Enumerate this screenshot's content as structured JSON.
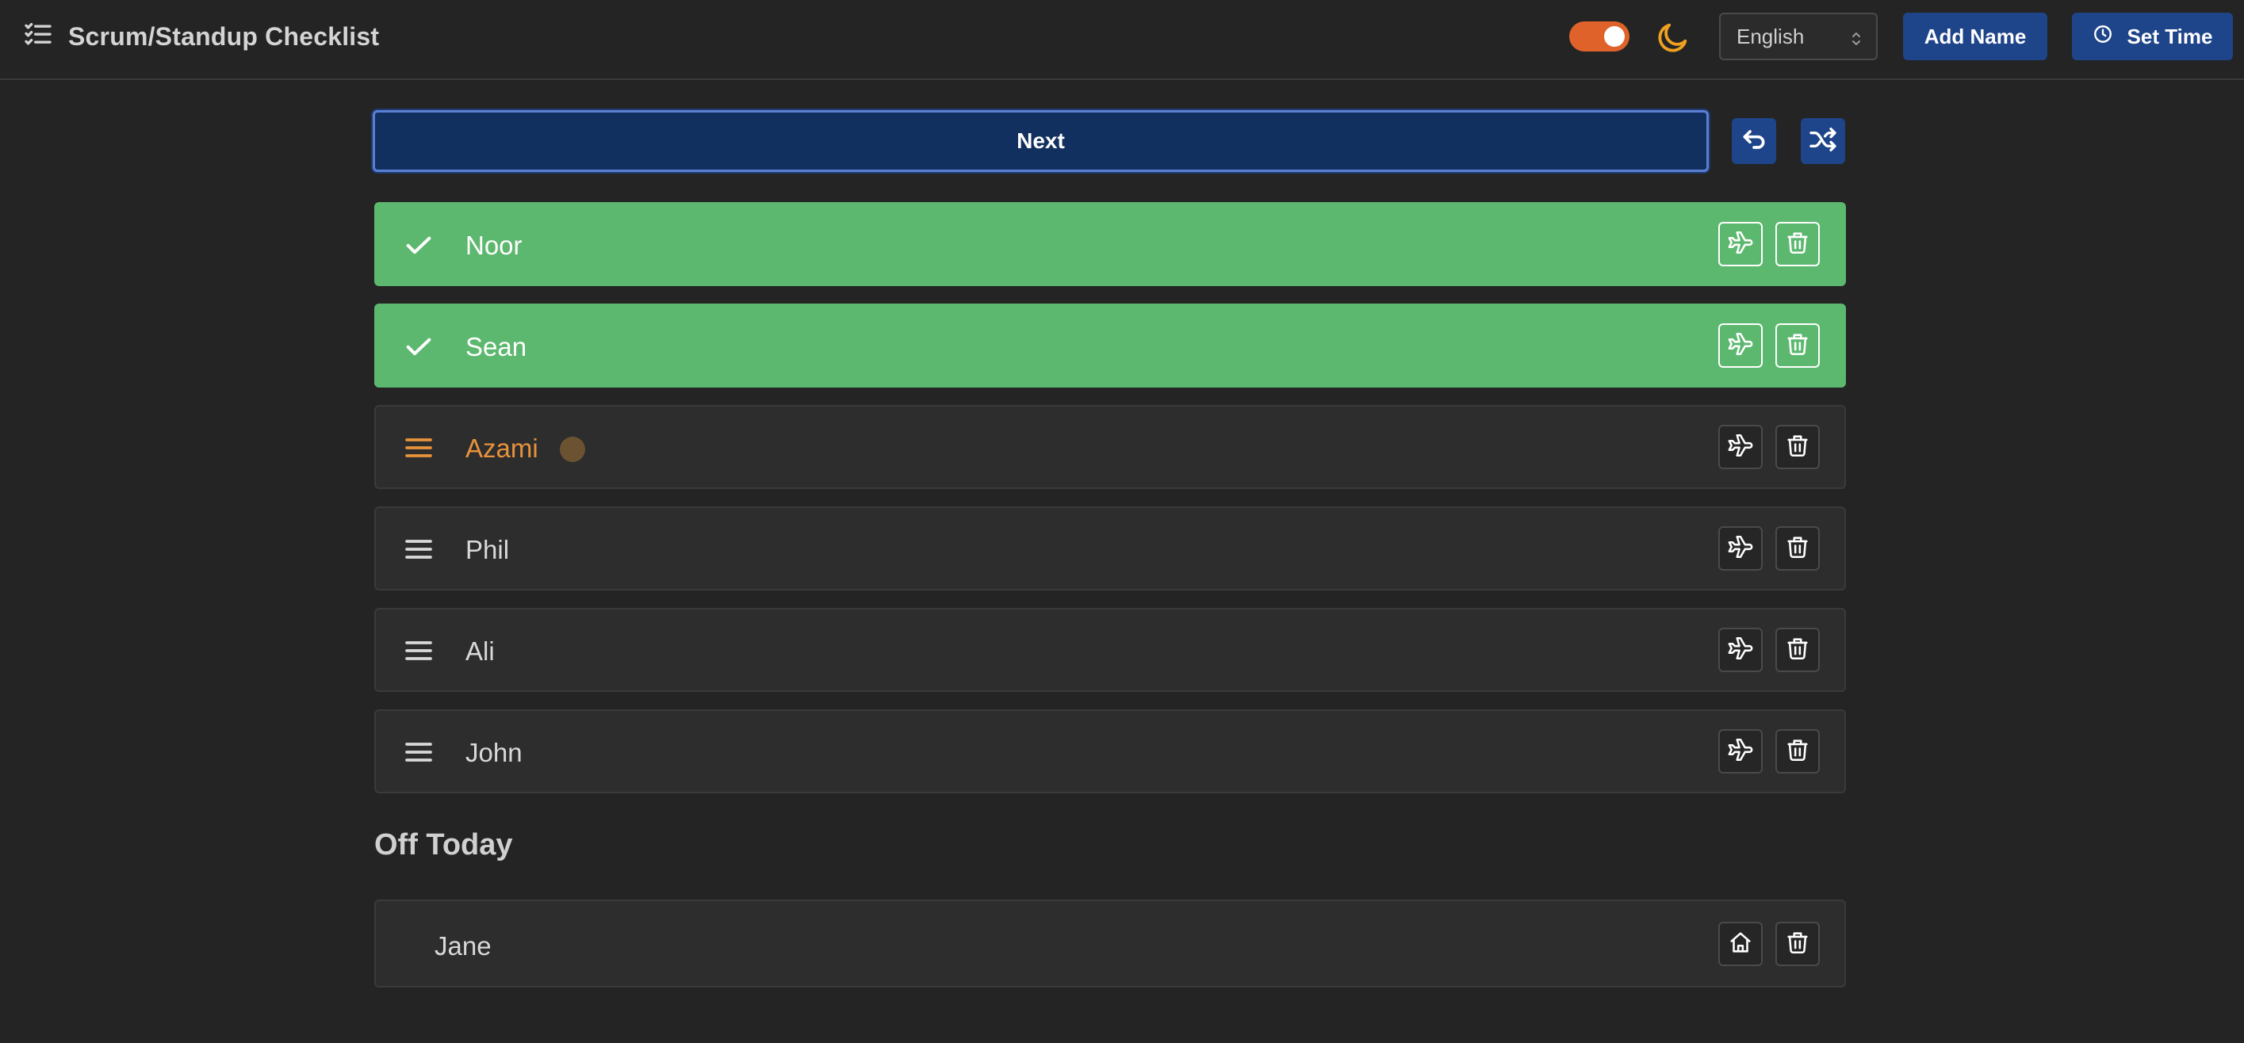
{
  "header": {
    "title": "Scrum/Standup Checklist",
    "language": "English",
    "add_name_label": "Add Name",
    "set_time_label": "Set Time",
    "toggle_on": true,
    "accent_toggle": "#e0622b",
    "accent_moon": "#f0a020"
  },
  "controls": {
    "next_label": "Next"
  },
  "members": [
    {
      "name": "Noor",
      "status": "done"
    },
    {
      "name": "Sean",
      "status": "done"
    },
    {
      "name": "Azami",
      "status": "current"
    },
    {
      "name": "Phil",
      "status": "pending"
    },
    {
      "name": "Ali",
      "status": "pending"
    },
    {
      "name": "John",
      "status": "pending"
    }
  ],
  "off_today": {
    "title": "Off Today",
    "members": [
      {
        "name": "Jane"
      }
    ]
  },
  "colors": {
    "background": "#242424",
    "done_row": "#5db86f",
    "current_name": "#e8923b",
    "primary_button": "#1e4489"
  }
}
